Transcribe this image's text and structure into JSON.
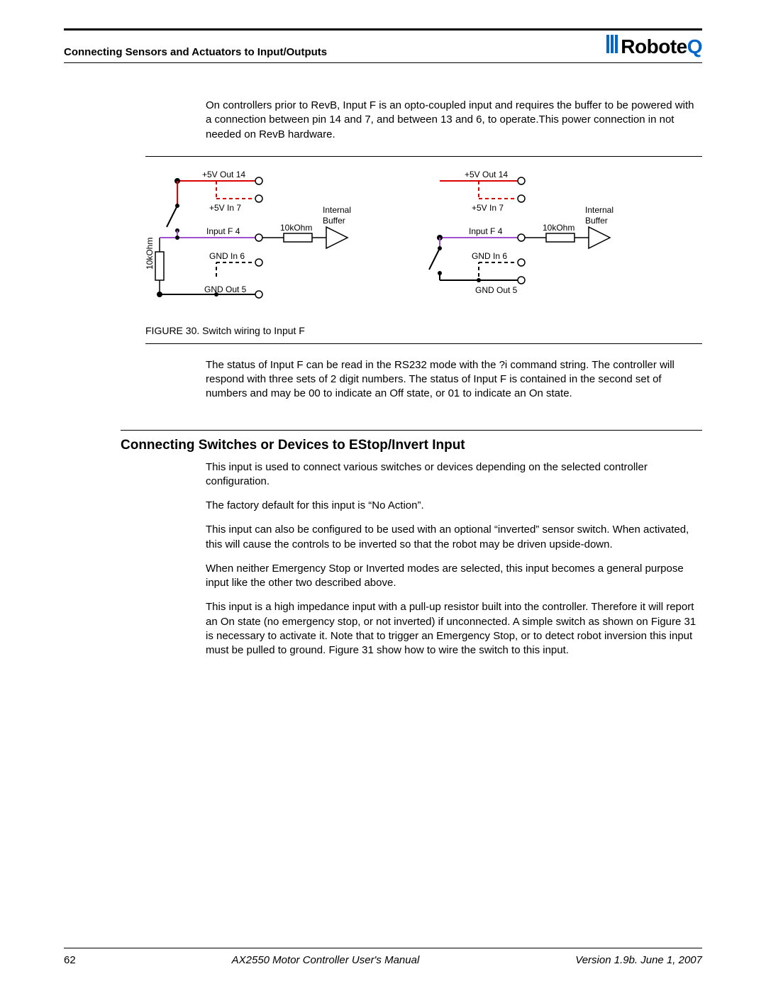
{
  "header": {
    "section": "Connecting Sensors and Actuators to Input/Outputs",
    "logo_main": "Robote",
    "logo_q": "Q"
  },
  "p1": "On controllers prior to RevB, Input F is an opto-coupled input and requires the buffer to be powered with a connection between pin 14 and 7, and between 13 and 6, to operate.This power connection in not needed on RevB hardware.",
  "figure": {
    "caption": "FIGURE 30.  Switch wiring to Input F",
    "labels": {
      "v5out": "+5V Out  14",
      "v5in": "+5V In  7",
      "inputf": "Input F  4",
      "gndin": "GND In  6",
      "gndout": "GND Out  5",
      "r10k": "10kOhm",
      "buf1": "Internal",
      "buf2": "Buffer"
    }
  },
  "p2": "The status of Input F can be read in the RS232 mode with the ?i command string. The controller will respond with three sets of 2 digit numbers. The status of Input F is contained in the second set of numbers and may be 00 to indicate an Off state, or 01 to indicate an On state.",
  "h2": "Connecting Switches or Devices to EStop/Invert Input",
  "p3": "This input is used to connect various switches or devices depending on the selected controller configuration.",
  "p4": "The factory default for this input is “No Action”.",
  "p5": "This input can also be configured to be used with an optional “inverted” sensor switch. When activated, this will cause the controls to be inverted so that the robot may be driven upside-down.",
  "p6": "When neither Emergency Stop or Inverted modes are selected, this input becomes a general purpose input like the other two described above.",
  "p7": "This input is a high impedance input with a pull-up resistor built into the controller. Therefore it will report an On state (no emergency stop, or not inverted) if unconnected. A simple switch as shown on Figure 31 is necessary to activate it. Note that to trigger an Emergency Stop, or to detect robot inversion this input must be pulled to ground. Figure 31 show how to wire the switch to this input.",
  "footer": {
    "page": "62",
    "title": "AX2550 Motor Controller User's Manual",
    "version": "Version 1.9b. June 1, 2007"
  }
}
